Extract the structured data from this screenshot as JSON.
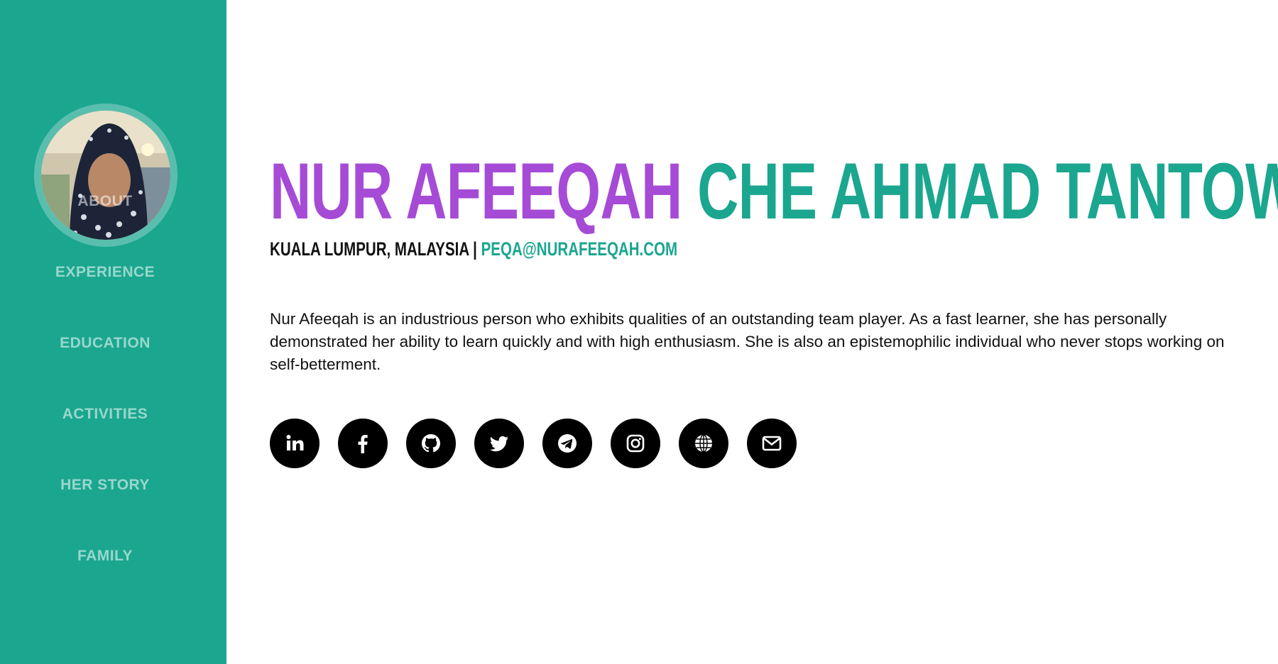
{
  "sidebar": {
    "nav": [
      "About",
      "Experience",
      "Education",
      "Activities",
      "Her Story",
      "Family"
    ]
  },
  "profile": {
    "first_name": "NUR AFEEQAH",
    "last_name": "CHE AHMAD TANTOWI",
    "location": "KUALA LUMPUR, MALAYSIA",
    "separator": "|",
    "email": "PEQA@NURAFEEQAH.COM",
    "bio": "Nur Afeeqah is an industrious person who exhibits qualities of an outstanding team player. As a fast learner, she has personally demonstrated her ability to learn quickly and with high enthusiasm. She is also an epistemophilic individual who never stops working on self-betterment."
  },
  "socials": [
    "linkedin-icon",
    "facebook-icon",
    "github-icon",
    "twitter-icon",
    "telegram-icon",
    "instagram-icon",
    "globe-icon",
    "envelope-icon"
  ],
  "colors": {
    "sidebar": "#1ba68f",
    "first_name": "#a64bd6",
    "last_name": "#1ba68f",
    "icon_bg": "#000000"
  }
}
